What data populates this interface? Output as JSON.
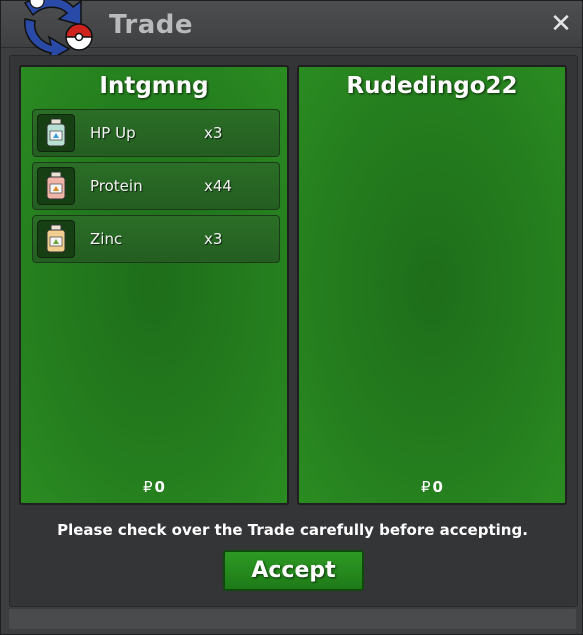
{
  "window": {
    "title": "Trade",
    "close_label": "✕"
  },
  "left": {
    "name": "Intgmng",
    "items": [
      {
        "icon": "hp-up-bottle-icon",
        "name": "HP Up",
        "qty": "x3"
      },
      {
        "icon": "protein-bottle-icon",
        "name": "Protein",
        "qty": "x44"
      },
      {
        "icon": "zinc-bottle-icon",
        "name": "Zinc",
        "qty": "x3"
      }
    ],
    "money_symbol": "₽",
    "money": "0"
  },
  "right": {
    "name": "Rudedingo22",
    "items": [],
    "money_symbol": "₽",
    "money": "0"
  },
  "notice": "Please check over the Trade carefully before accepting.",
  "accept_label": "Accept",
  "colors": {
    "panel_green": "#257f1e",
    "accept_green": "#2e9a24",
    "title_text": "#b9babc",
    "icon_blue": "#2a4aa8",
    "icon_red": "#d0231e"
  }
}
